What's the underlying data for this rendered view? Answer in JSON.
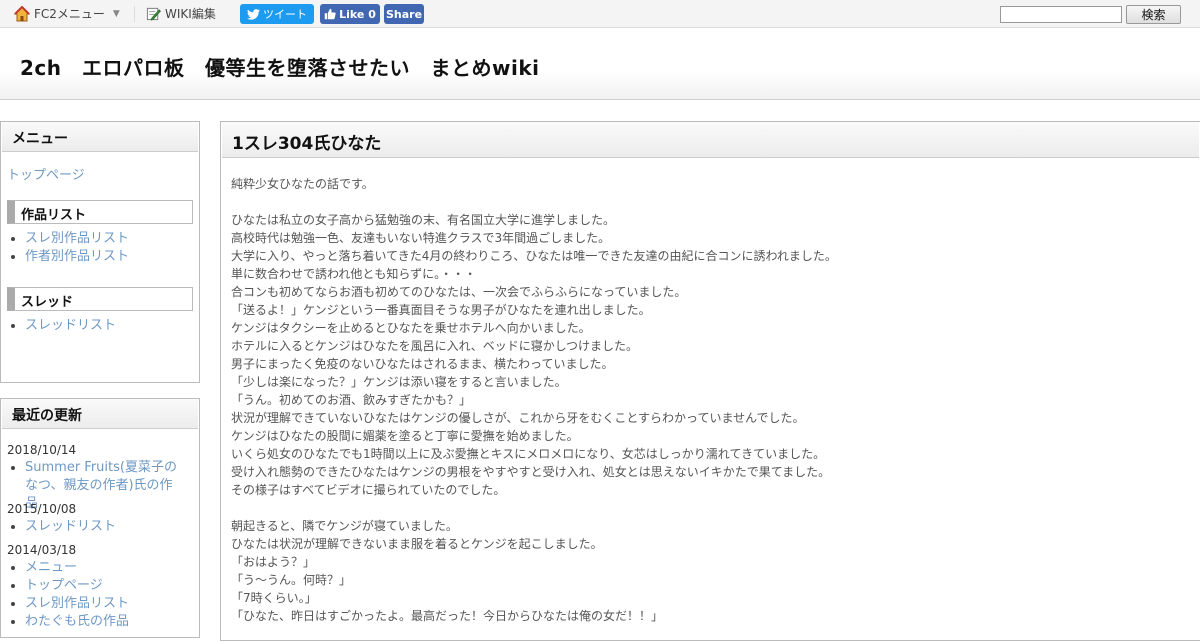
{
  "topbar": {
    "fc2_menu": "FC2メニュー",
    "wiki_edit": "WIKI編集",
    "tweet": "ツイート",
    "like": "Like 0",
    "share": "Share",
    "search_value": "",
    "search_button": "検索"
  },
  "header": {
    "title": "2ch　エロパロ板　優等生を堕落させたい　まとめwiki"
  },
  "menu_panel": {
    "title": "メニュー",
    "top_link": "トップページ",
    "works_head": "作品リスト",
    "works_links": [
      "スレ別作品リスト",
      "作者別作品リスト"
    ],
    "thread_head": "スレッド",
    "thread_links": [
      "スレッドリスト"
    ]
  },
  "recent_panel": {
    "title": "最近の更新",
    "groups": [
      {
        "date": "2018/10/14",
        "items": [
          "Summer Fruits(夏菜子のなつ、親友の作者)氏の作品"
        ]
      },
      {
        "date": "2015/10/08",
        "items": [
          "スレッドリスト"
        ]
      },
      {
        "date": "2014/03/18",
        "items": [
          "メニュー",
          "トップページ",
          "スレ別作品リスト",
          "わたぐも氏の作品"
        ]
      }
    ]
  },
  "article": {
    "title": "1スレ304氏ひなた",
    "lines": [
      "純粋少女ひなたの話です。",
      "",
      "ひなたは私立の女子高から猛勉強の末、有名国立大学に進学しました。",
      "高校時代は勉強一色、友達もいない特進クラスで3年間過ごしました。",
      "大学に入り、やっと落ち着いてきた4月の終わりころ、ひなたは唯一できた友達の由紀に合コンに誘われました。",
      "単に数合わせで誘われ他とも知らずに。・・・",
      "合コンも初めてならお酒も初めてのひなたは、一次会でふらふらになっていました。",
      "「送るよ！」ケンジという一番真面目そうな男子がひなたを連れ出しました。",
      "ケンジはタクシーを止めるとひなたを乗せホテルへ向かいました。",
      "ホテルに入るとケンジはひなたを風呂に入れ、ベッドに寝かしつけました。",
      "男子にまったく免疫のないひなたはされるまま、横たわっていました。",
      "「少しは楽になった？」ケンジは添い寝をすると言いました。",
      "「うん。初めてのお酒、飲みすぎたかも？」",
      "状況が理解できていないひなたはケンジの優しさが、これから牙をむくことすらわかっていませんでした。",
      "ケンジはひなたの股間に媚薬を塗ると丁寧に愛撫を始めました。",
      "いくら処女のひなたでも1時間以上に及ぶ愛撫とキスにメロメロになり、女芯はしっかり濡れてきていました。",
      "受け入れ態勢のできたひなたはケンジの男根をやすやすと受け入れ、処女とは思えないイキかたで果てました。",
      "その様子はすべてビデオに撮られていたのでした。",
      "",
      "朝起きると、隣でケンジが寝ていました。",
      "ひなたは状況が理解できないまま服を着るとケンジを起こしました。",
      "「おはよう？」",
      "「う～うん。何時？」",
      "「7時くらい。」",
      "「ひなた、昨日はすごかったよ。最高だった！今日からひなたは俺の女だ！！」"
    ]
  }
}
